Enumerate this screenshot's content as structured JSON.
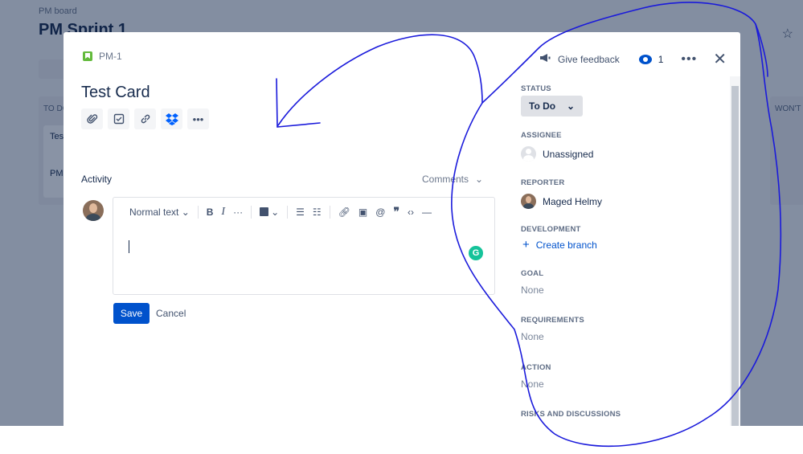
{
  "board": {
    "breadcrumb": "PM board",
    "sprint_title": "PM Sprint 1",
    "columns": [
      {
        "title": "TO DO"
      },
      {
        "title": "WON'T"
      }
    ],
    "card_title": "Test",
    "card_key": "PM"
  },
  "issue": {
    "key": "PM-1",
    "title": "Test Card",
    "toolbar_icons": [
      "paperclip-icon",
      "checklist-icon",
      "link-icon",
      "dropbox-icon",
      "more-icon"
    ]
  },
  "header": {
    "feedback_label": "Give feedback",
    "watch_count": "1"
  },
  "activity": {
    "label": "Activity",
    "filter": "Comments",
    "editor": {
      "text_style": "Normal text",
      "bold": "B",
      "italic": "I"
    },
    "save_label": "Save",
    "cancel_label": "Cancel"
  },
  "sidebar": {
    "status": {
      "label": "STATUS",
      "value": "To Do"
    },
    "assignee": {
      "label": "ASSIGNEE",
      "value": "Unassigned"
    },
    "reporter": {
      "label": "REPORTER",
      "value": "Maged Helmy"
    },
    "development": {
      "label": "DEVELOPMENT",
      "value": "Create branch"
    },
    "goal": {
      "label": "GOAL",
      "value": "None"
    },
    "requirements": {
      "label": "REQUIREMENTS",
      "value": "None"
    },
    "action": {
      "label": "ACTION",
      "value": "None"
    },
    "risks": {
      "label": "RISKS AND DISCUSSIONS"
    }
  },
  "colors": {
    "primary": "#0052cc",
    "annotation_ink": "#1a1adb"
  }
}
